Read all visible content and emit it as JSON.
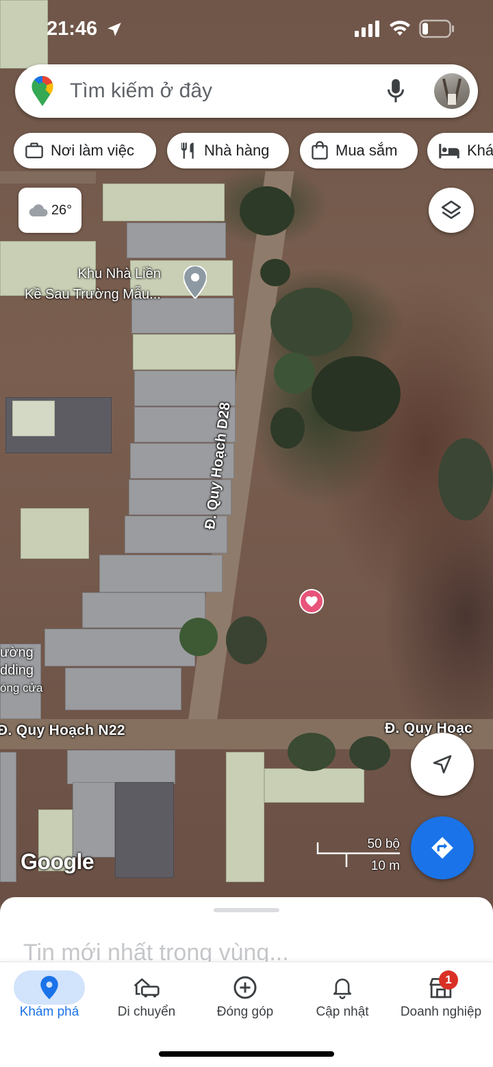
{
  "status_bar": {
    "time": "21:46"
  },
  "search": {
    "placeholder": "Tìm kiếm ở đây"
  },
  "chips": [
    {
      "label": "Nơi làm việc",
      "icon": "briefcase-icon"
    },
    {
      "label": "Nhà hàng",
      "icon": "fork-knife-icon"
    },
    {
      "label": "Mua sắm",
      "icon": "shopping-bag-icon"
    },
    {
      "label": "Khá",
      "icon": "bed-icon"
    }
  ],
  "weather": {
    "temperature": "26°",
    "icon": "cloud-icon"
  },
  "map": {
    "poi_line1": "Khu Nhà Liền",
    "poi_line2": "Kề Sau Trường Mẫu...",
    "road_d28": "Đ. Quy Hoạch D28",
    "road_n22": "Đ. Quy Hoạch N22",
    "road_right": "Đ. Quy Hoạc",
    "side_label_1": "ường",
    "side_label_2": "dding",
    "side_label_3": "óng cửa",
    "attribution": "Google",
    "scale_feet": "50 bộ",
    "scale_meters": "10 m"
  },
  "sheet": {
    "title": "Tin mới nhất trong vùng..."
  },
  "nav": {
    "explore": "Khám phá",
    "commute": "Di chuyển",
    "contribute": "Đóng góp",
    "updates": "Cập nhật",
    "business": "Doanh nghiệp",
    "business_badge": "1"
  },
  "colors": {
    "accent": "#1a73e8",
    "active_bg": "#d2e3fc",
    "saved_pin": "#e8537a",
    "badge": "#d93025"
  }
}
